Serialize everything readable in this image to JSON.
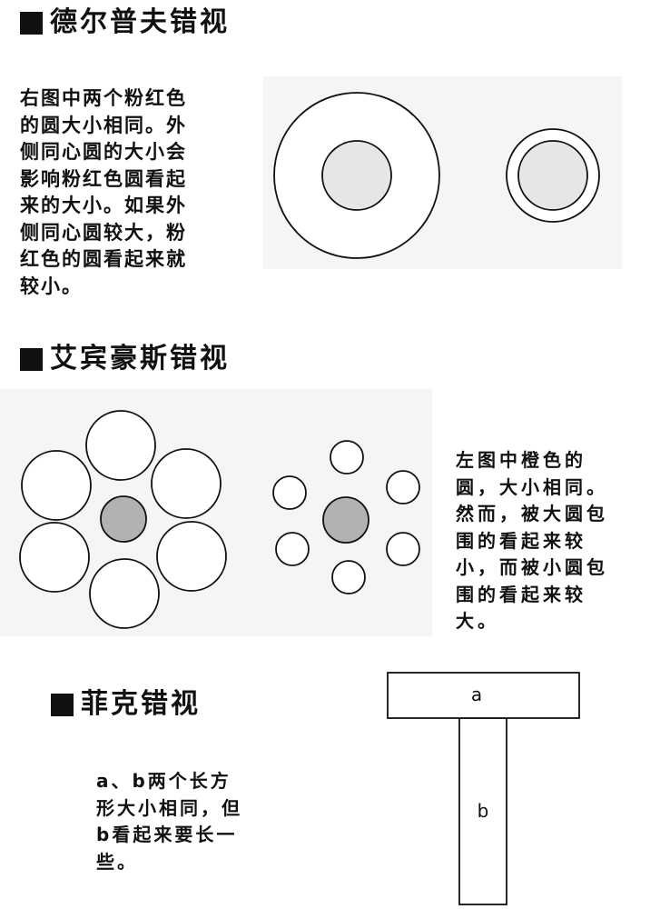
{
  "sections": [
    {
      "heading": "德尔普夫错视",
      "text_lines": [
        "右图中两个粉红色",
        "的圆大小相同。外",
        "侧同心圆的大小会",
        "影响粉红色圆看起",
        "来的大小。如果外",
        "侧同心圆较大，粉",
        "红色的圆看起来就",
        "较小。"
      ]
    },
    {
      "heading": "艾宾豪斯错视",
      "text_lines": [
        "左图中橙色的",
        "圆，大小相同。",
        "然而，被大圆包",
        "围的看起来较",
        "小，而被小圆包",
        "围的看起来较",
        "大。"
      ]
    },
    {
      "heading": "菲克错视",
      "text_lines": [
        "a、b两个长方",
        "形大小相同，但",
        "b看起来要长一",
        "些。"
      ],
      "labels": {
        "a": "a",
        "b": "b"
      }
    }
  ],
  "colors": {
    "panel": "#f5f5f5",
    "inner_circle": "#e6e6e6",
    "center_circle": "#b2b2b2",
    "stroke": "#111111"
  }
}
